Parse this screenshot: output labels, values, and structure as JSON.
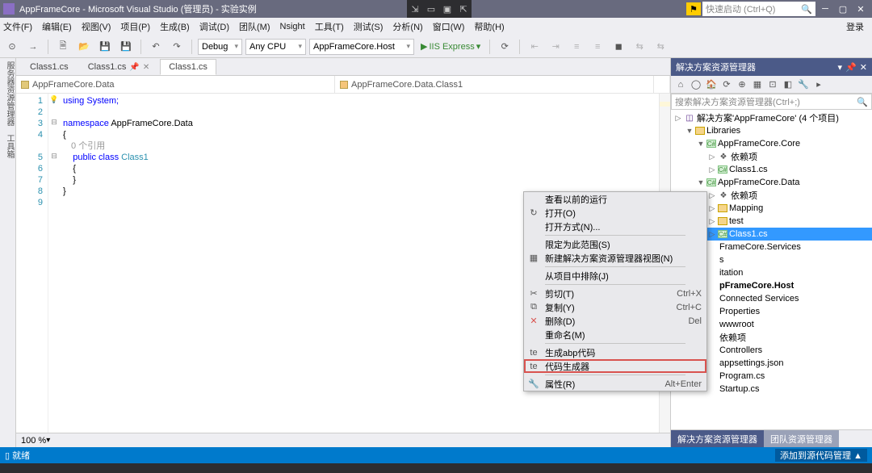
{
  "title": "AppFrameCore - Microsoft Visual Studio (管理员) - 实验实例",
  "quick_launch_placeholder": "快速启动 (Ctrl+Q)",
  "menubar": [
    "文件(F)",
    "编辑(E)",
    "视图(V)",
    "项目(P)",
    "生成(B)",
    "调试(D)",
    "团队(M)",
    "Nsight",
    "工具(T)",
    "测试(S)",
    "分析(N)",
    "窗口(W)",
    "帮助(H)"
  ],
  "login": "登录",
  "toolbar": {
    "config": "Debug",
    "platform": "Any CPU",
    "startup": "AppFrameCore.Host",
    "run": "IIS Express"
  },
  "tabs": [
    {
      "name": "Class1.cs",
      "active": false,
      "pinned": false
    },
    {
      "name": "Class1.cs",
      "active": false,
      "pinned": true
    },
    {
      "name": "Class1.cs",
      "active": true,
      "pinned": false
    }
  ],
  "nav": {
    "left": "AppFrameCore.Data",
    "right": "AppFrameCore.Data.Class1"
  },
  "code_lines": [
    "1",
    "2",
    "3",
    "4",
    "5",
    "6",
    "7",
    "8",
    "9"
  ],
  "code": {
    "l1": "using System;",
    "l3a": "namespace",
    "l3b": " AppFrameCore.Data",
    "l4": "{",
    "ref": "0 个引用",
    "l5a": "    public class ",
    "l5b": "Class1",
    "l6": "    {",
    "l7": "    }",
    "l8": "}"
  },
  "zoom": "100 %",
  "left_strip": "服务器资源管理器　工具箱",
  "solution": {
    "header": "解决方案资源管理器",
    "search_placeholder": "搜索解决方案资源管理器(Ctrl+;)",
    "root": "解决方案'AppFrameCore' (4 个项目)",
    "tree": [
      {
        "d": 1,
        "exp": "▼",
        "ico": "fld",
        "lbl": "Libraries"
      },
      {
        "d": 2,
        "exp": "▼",
        "ico": "cs",
        "lbl": "AppFrameCore.Core"
      },
      {
        "d": 3,
        "exp": "▷",
        "ico": "dep",
        "lbl": "依赖项"
      },
      {
        "d": 3,
        "exp": "▷",
        "ico": "cs",
        "lbl": "Class1.cs"
      },
      {
        "d": 2,
        "exp": "▼",
        "ico": "cs",
        "lbl": "AppFrameCore.Data"
      },
      {
        "d": 3,
        "exp": "▷",
        "ico": "dep",
        "lbl": "依赖项"
      },
      {
        "d": 3,
        "exp": "▷",
        "ico": "fld",
        "lbl": "Mapping"
      },
      {
        "d": 3,
        "exp": "▷",
        "ico": "fld",
        "lbl": "test"
      },
      {
        "d": 3,
        "exp": "▷",
        "ico": "cs",
        "lbl": "Class1.cs",
        "sel": true
      },
      {
        "d": 2,
        "exp": "",
        "ico": "",
        "lbl": "FrameCore.Services"
      },
      {
        "d": 2,
        "exp": "",
        "ico": "",
        "lbl": "s"
      },
      {
        "d": 2,
        "exp": "",
        "ico": "",
        "lbl": "itation"
      },
      {
        "d": 2,
        "exp": "",
        "ico": "",
        "lbl": "pFrameCore.Host",
        "bold": true
      },
      {
        "d": 2,
        "exp": "",
        "ico": "",
        "lbl": "Connected Services"
      },
      {
        "d": 2,
        "exp": "",
        "ico": "",
        "lbl": "Properties"
      },
      {
        "d": 2,
        "exp": "",
        "ico": "",
        "lbl": "wwwroot"
      },
      {
        "d": 2,
        "exp": "",
        "ico": "",
        "lbl": "依赖项"
      },
      {
        "d": 2,
        "exp": "",
        "ico": "",
        "lbl": "Controllers"
      },
      {
        "d": 2,
        "exp": "",
        "ico": "",
        "lbl": "appsettings.json"
      },
      {
        "d": 2,
        "exp": "",
        "ico": "",
        "lbl": "Program.cs"
      },
      {
        "d": 2,
        "exp": "",
        "ico": "",
        "lbl": "Startup.cs"
      }
    ],
    "tabs": [
      "解决方案资源管理器",
      "团队资源管理器"
    ]
  },
  "context_menu": [
    {
      "label": "查看以前的运行"
    },
    {
      "label": "打开(O)",
      "ico": "↻"
    },
    {
      "label": "打开方式(N)..."
    },
    {
      "sep": true
    },
    {
      "label": "限定为此范围(S)"
    },
    {
      "label": "新建解决方案资源管理器视图(N)",
      "ico": "▦"
    },
    {
      "sep": true
    },
    {
      "label": "从项目中排除(J)"
    },
    {
      "sep": true
    },
    {
      "label": "剪切(T)",
      "sc": "Ctrl+X",
      "ico": "✂"
    },
    {
      "label": "复制(Y)",
      "sc": "Ctrl+C",
      "ico": "⧉"
    },
    {
      "label": "删除(D)",
      "sc": "Del",
      "ico": "✕",
      "red": true
    },
    {
      "label": "重命名(M)"
    },
    {
      "sep": true
    },
    {
      "label": "生成abp代码",
      "ico": "te"
    },
    {
      "label": "代码生成器",
      "ico": "te",
      "hl": true
    },
    {
      "sep": true
    },
    {
      "label": "属性(R)",
      "sc": "Alt+Enter",
      "ico": "🔧"
    }
  ],
  "statusbar": {
    "left": "就绪",
    "right": "添加到源代码管理 ▲"
  }
}
